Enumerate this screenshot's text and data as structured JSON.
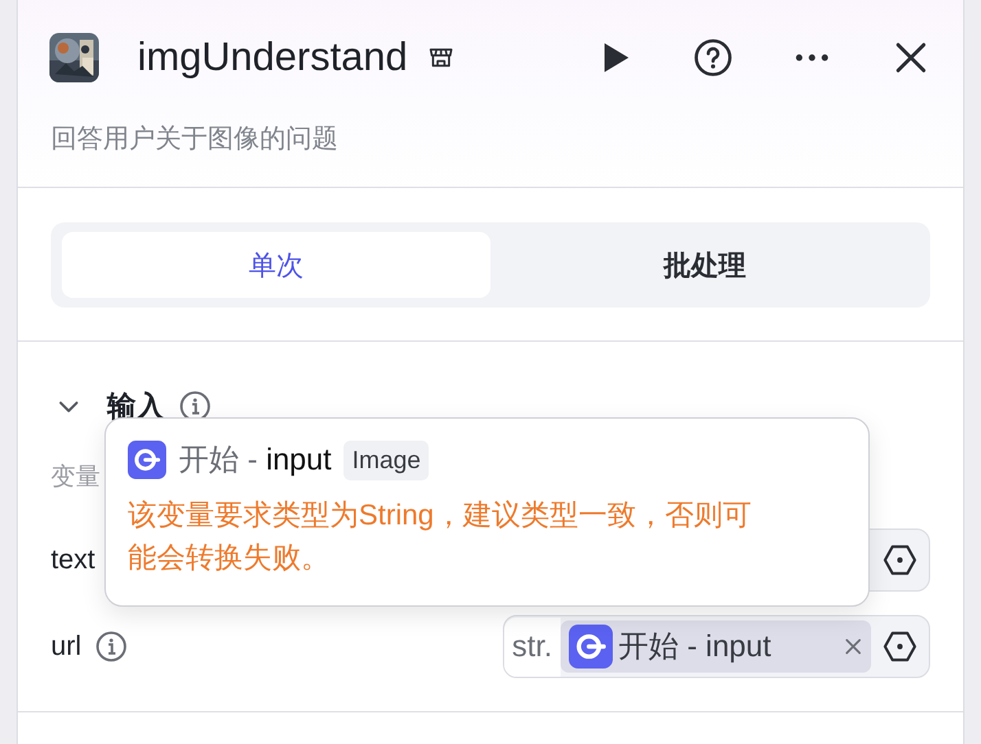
{
  "header": {
    "title": "imgUnderstand",
    "description": "回答用户关于图像的问题"
  },
  "tabs": [
    {
      "label": "单次",
      "selected": true
    },
    {
      "label": "批处理",
      "selected": false
    }
  ],
  "input_section": {
    "title": "输入",
    "expanded": true,
    "column_header": "变量",
    "params": [
      {
        "name": "text"
      },
      {
        "name": "url",
        "info": true,
        "type_tag": "str.",
        "reference": {
          "node": "开始",
          "separator": "-",
          "variable": "input"
        }
      }
    ]
  },
  "tooltip": {
    "node": "开始",
    "separator": "-",
    "variable": "input",
    "type": "Image",
    "message": "该变量要求类型为String，建议类型一致，否则可能会转换失败。"
  }
}
